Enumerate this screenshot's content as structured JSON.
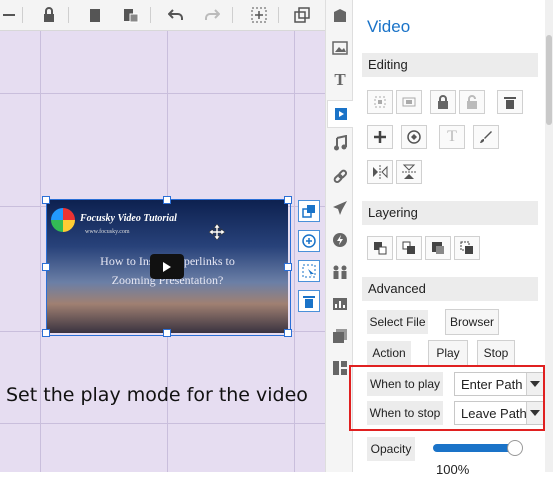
{
  "toolbar": {
    "buttons": [
      "hide-icon",
      "lock-icon",
      "copy-icon",
      "paste-icon",
      "undo-icon",
      "redo-icon",
      "group-select-icon",
      "window-icon"
    ]
  },
  "canvas": {
    "video": {
      "title": "Focusky Video Tutorial",
      "url": "www.focusky.com",
      "text_line1": "How to Insert Hyperlinks to",
      "text_line2": "Zooming Presentation?"
    },
    "caption": "Set the play mode for the video"
  },
  "panel": {
    "title": "Video",
    "editing_label": "Editing",
    "layering_label": "Layering",
    "advanced_label": "Advanced",
    "select_file_label": "Select File",
    "browser_label": "Browser",
    "action_label": "Action",
    "play_label": "Play",
    "stop_label": "Stop",
    "when_to_play_label": "When to play",
    "when_to_play_value": "Enter Path",
    "when_to_stop_label": "When to stop",
    "when_to_stop_value": "Leave Path",
    "opacity_label": "Opacity",
    "opacity_value": "100%",
    "opacity_fraction": 1.0
  },
  "colors": {
    "accent": "#1a73c8",
    "highlight_box": "#e02020",
    "canvas_bg": "#e6ddf1"
  }
}
